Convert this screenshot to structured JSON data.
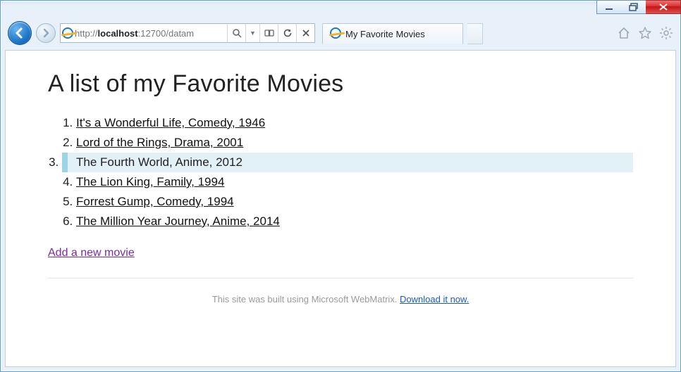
{
  "window": {
    "minimize_tip": "Minimize",
    "maximize_tip": "Restore",
    "close_tip": "Close"
  },
  "nav": {
    "back_tip": "Back",
    "forward_tip": "Forward",
    "url_host": "localhost",
    "url_port": ":12700",
    "url_path": "/datam",
    "search_tip": "Search",
    "dropdown_tip": "Show address bar autocomplete",
    "compat_tip": "Compatibility View",
    "refresh_tip": "Refresh",
    "stop_tip": "Stop",
    "home_tip": "Home",
    "favorites_tip": "Favorites",
    "tools_tip": "Tools"
  },
  "tab": {
    "title": "My Favorite Movies"
  },
  "page": {
    "heading": "A list of my Favorite Movies",
    "movies": [
      {
        "title": "It's a Wonderful Life",
        "genre": "Comedy",
        "year": "1946",
        "highlight": false
      },
      {
        "title": "Lord of the Rings",
        "genre": "Drama",
        "year": "2001",
        "highlight": false
      },
      {
        "title": "The Fourth World",
        "genre": "Anime",
        "year": "2012",
        "highlight": true
      },
      {
        "title": "The Lion King",
        "genre": "Family",
        "year": "1994",
        "highlight": false
      },
      {
        "title": "Forrest Gump",
        "genre": "Comedy",
        "year": "1994",
        "highlight": false
      },
      {
        "title": "The Million Year Journey",
        "genre": "Anime",
        "year": "2014",
        "highlight": false
      }
    ],
    "add_new_label": "Add a new movie",
    "footer_text": "This site was built using Microsoft WebMatrix. ",
    "footer_link": "Download it now."
  }
}
